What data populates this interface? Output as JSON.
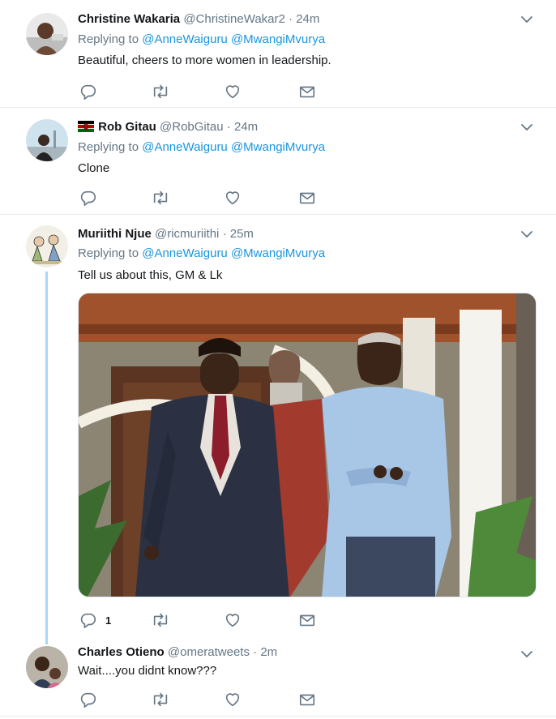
{
  "tweets": [
    {
      "name": "Christine Wakaria",
      "handle": "@ChristineWakar2",
      "time": "24m",
      "replying_label": "Replying to",
      "mentions": [
        "@AnneWaiguru",
        "@MwangiMvurya"
      ],
      "text": "Beautiful, cheers to more women in leadership."
    },
    {
      "name": "Rob Gitau",
      "handle": "@RobGitau",
      "time": "24m",
      "replying_label": "Replying to",
      "mentions": [
        "@AnneWaiguru",
        "@MwangiMvurya"
      ],
      "text": "Clone"
    },
    {
      "name": "Muriithi Njue",
      "handle": "@ricmuriithi",
      "time": "25m",
      "replying_label": "Replying to",
      "mentions": [
        "@AnneWaiguru",
        "@MwangiMvurya"
      ],
      "text": "Tell us about this, GM & Lk",
      "reply_count": "1"
    },
    {
      "name": "Charles Otieno",
      "handle": "@omeratweets",
      "time": "2m",
      "text": "Wait....you didnt know???"
    }
  ],
  "separator": "·",
  "icons": {
    "reply": "reply-icon",
    "retweet": "retweet-icon",
    "like": "heart-icon",
    "dm": "envelope-icon",
    "more": "chevron-down-icon"
  },
  "colors": {
    "link": "#1b95e0",
    "secondary_text": "#657786",
    "icon": "#657786",
    "thread_line": "#a6d7f5",
    "divider": "#e6ecf0"
  }
}
